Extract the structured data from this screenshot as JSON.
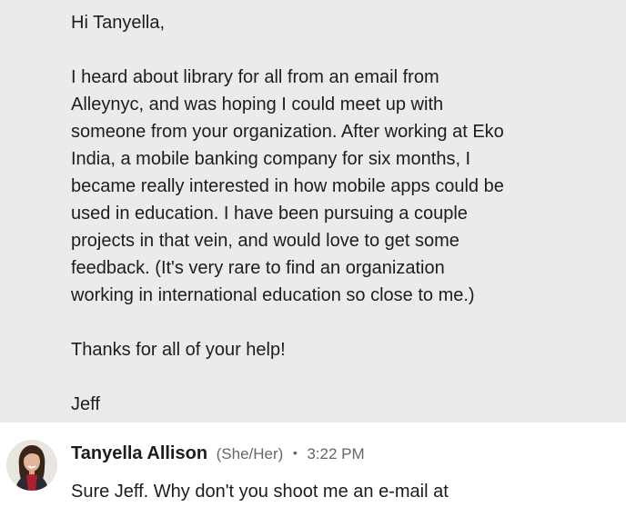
{
  "message_1": {
    "lines": [
      "Hi Tanyella,",
      "",
      "I heard about library for all from an email from",
      "Alleynyc, and was hoping I could meet up with",
      "someone from your organization. After working at Eko",
      "India, a mobile banking company for six months, I",
      "became really interested in how mobile apps could be",
      "used in education. I have been pursuing a couple",
      "projects in that vein, and would love to get some",
      "feedback. (It's very rare to find an organization",
      "working in international education so close to me.)",
      "",
      "Thanks for all of your help!",
      "",
      "Jeff"
    ]
  },
  "message_2": {
    "sender_name": "Tanyella Allison",
    "pronouns": "(She/Her)",
    "separator": "•",
    "timestamp": "3:22 PM",
    "text": "Sure Jeff. Why don't you shoot me an e-mail at"
  },
  "colors": {
    "highlight_bg": "#ebebeb",
    "text": "#1d1d1d",
    "meta": "#666666"
  }
}
